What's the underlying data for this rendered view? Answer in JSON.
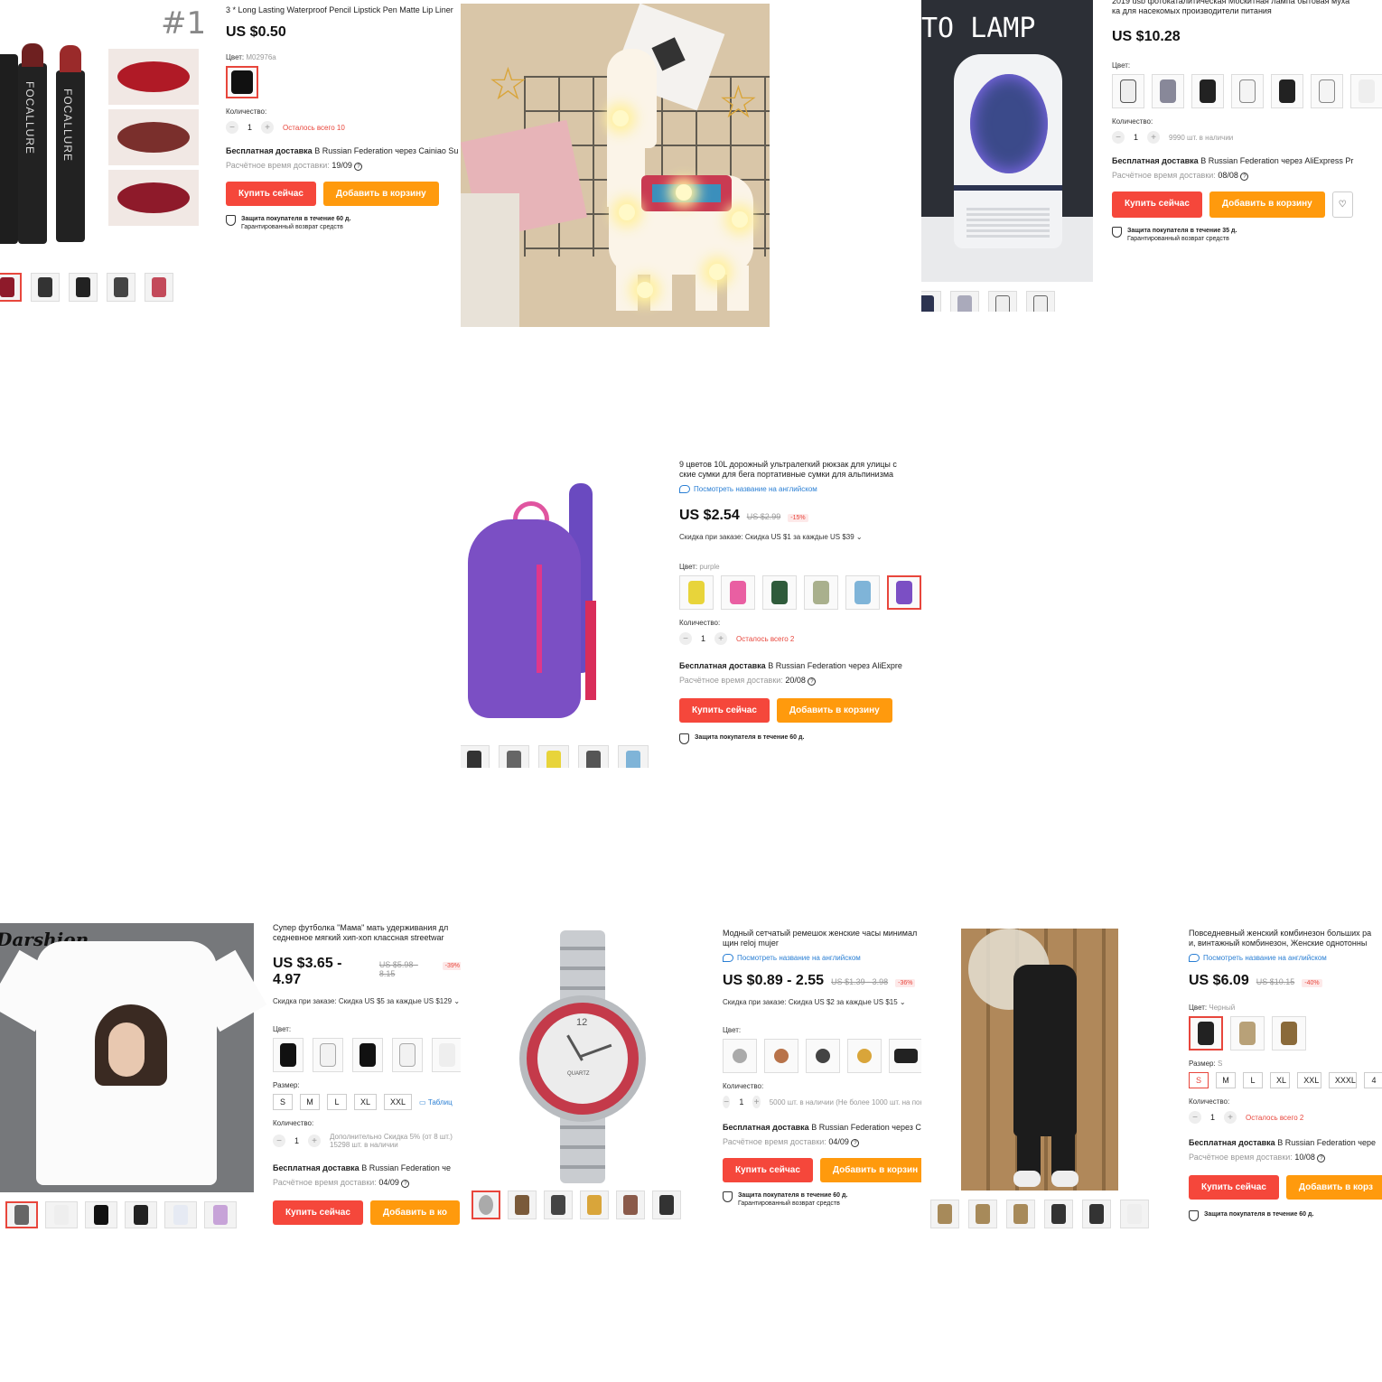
{
  "common": {
    "buy_now": "Купить сейчас",
    "add_to_cart": "Добавить в корзину",
    "add_to_cart_cut": "Добавить в корзин",
    "add_to_cart_cut2": "Добавить в ко",
    "add_to_cart_cut3": "Добавить в корз",
    "color_label": "Цвет:",
    "size_label": "Размер:",
    "qty_label": "Количество:",
    "free_shipping": "Бесплатная доставка",
    "eta_label": "Расчётное время доставки:",
    "protection": "Защита покупателя в течение 60 д.",
    "refund": "Гарантированный возврат средств",
    "view_english": "Посмотреть название на английском"
  },
  "lipstick": {
    "badge": "#1",
    "brand": "FOCALLURE",
    "title": "3 * Long Lasting Waterproof Pencil Lipstick Pen Matte Lip Liner",
    "price": "US $0.50",
    "color_value": "M02976a",
    "qty": "1",
    "stock": "Осталось всего 10",
    "shipping": "В Russian Federation через Cainiao Su",
    "eta": "19/09"
  },
  "llama": {},
  "lamp": {
    "banner": "TO LAMP",
    "title": "2019 usb фотокаталитическая Москитная лампа бытовая муха\nка для насекомых производители питания",
    "price": "US $10.28",
    "qty": "1",
    "stock": "9990 шт. в наличии",
    "shipping": "В Russian Federation через AliExpress Pr",
    "eta": "08/08",
    "protection": "Защита покупателя в течение 35 д."
  },
  "backpack": {
    "title": "9 цветов 10L дорожный ультралегкий рюкзак для улицы с\nские сумки для бега портативные сумки для альпинизма",
    "price": "US $2.54",
    "old_price": "US $2.99",
    "discount": "-15%",
    "bulk": "Скидка при заказе: Скидка US $1 за каждые US $39 ⌄",
    "color_value": "purple",
    "qty": "1",
    "stock": "Осталось всего 2",
    "shipping": "В Russian Federation через AliExpre",
    "eta": "20/08",
    "colors": [
      "#e8d43a",
      "#e95fa2",
      "#2f5b3b",
      "#a9b08d",
      "#7fb4d8",
      "#7b4fc4"
    ]
  },
  "tshirt": {
    "brand": "Darshion",
    "title": "Супер футболка \"Мама\" мать удерживания дл\nседневное мягкий хип-хоп классная streetwar",
    "price": "US $3.65 - 4.97",
    "old_price": "US $5.98 - 8.15",
    "discount": "-39%",
    "bulk": "Скидка при заказе: Скидка US $5 за каждые US $129 ⌄",
    "sizes": [
      "S",
      "M",
      "L",
      "XL",
      "XXL"
    ],
    "size_table": "Таблиц",
    "qty": "1",
    "extra_discount": "Дополнительно Скидка 5% (от 8 шт.)",
    "stock": "15298 шт. в наличии",
    "shipping": "В Russian Federation че",
    "eta": "04/09"
  },
  "watch": {
    "title": "Модный сетчатый ремешок женские часы минимал\nщин reloj mujer",
    "dial_brand": "QUARTZ",
    "dial_12": "12",
    "price": "US $0.89 - 2.55",
    "old_price": "US $1.39 - 3.98",
    "discount": "-36%",
    "bulk": "Скидка при заказе: Скидка US $2 за каждые US $15 ⌄",
    "qty": "1",
    "stock": "5000 шт. в наличии (Не более 1000 шт. на пок",
    "shipping": "В Russian Federation через C",
    "eta": "04/09"
  },
  "jumpsuit": {
    "title": "Повседневный женский комбинезон больших ра\nи, винтажный комбинезон, Женские однотонны",
    "price": "US $6.09",
    "old_price": "US $10.15",
    "discount": "-40%",
    "color_value": "Черный",
    "size_value": "S",
    "sizes": [
      "S",
      "M",
      "L",
      "XL",
      "XXL",
      "XXXL",
      "4"
    ],
    "qty": "1",
    "stock": "Осталось всего 2",
    "shipping": "В Russian Federation чере",
    "eta": "10/08"
  }
}
